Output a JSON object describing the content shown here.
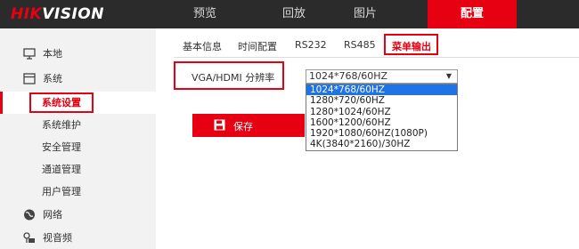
{
  "app": {
    "logo_part1": "HIK",
    "logo_part2": "VISION"
  },
  "nav": {
    "items": [
      "预览",
      "回放",
      "图片",
      "配置"
    ],
    "active": "配置"
  },
  "sidebar": {
    "items": [
      {
        "label": "本地",
        "icon": "monitor-icon"
      },
      {
        "label": "系统",
        "icon": "system-icon"
      },
      {
        "label": "系统设置"
      },
      {
        "label": "系统维护"
      },
      {
        "label": "安全管理"
      },
      {
        "label": "通道管理"
      },
      {
        "label": "用户管理"
      },
      {
        "label": "网络",
        "icon": "globe-icon"
      },
      {
        "label": "视音频",
        "icon": "audio-video-icon"
      }
    ],
    "active": "系统设置"
  },
  "tabs": {
    "items": [
      "基本信息",
      "时间配置",
      "RS232",
      "RS485",
      "菜单输出"
    ],
    "active": "菜单输出"
  },
  "form": {
    "vga_label": "VGA/HDMI 分辨率",
    "selected": "1024*768/60HZ",
    "options": [
      "1024*768/60HZ",
      "1280*720/60HZ",
      "1280*1024/60HZ",
      "1600*1200/60HZ",
      "1920*1080/60HZ(1080P)",
      "4K(3840*2160)/30HZ"
    ]
  },
  "actions": {
    "save_label": "保存"
  },
  "colors": {
    "brand_red": "#e60012",
    "topbar_bg": "#2b2b2b",
    "sidebar_bg": "#f2f2f2",
    "selection_blue": "#1e73e8"
  }
}
